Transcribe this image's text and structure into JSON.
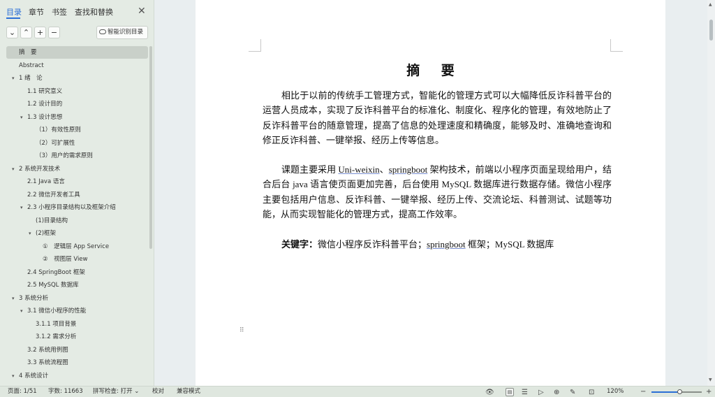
{
  "nav": {
    "tabs": [
      {
        "label": "目录",
        "active": true
      },
      {
        "label": "章节",
        "active": false
      },
      {
        "label": "书签",
        "active": false
      },
      {
        "label": "查找和替换",
        "active": false
      }
    ],
    "close_glyph": "✕",
    "toolbar": {
      "collapse_glyph": "⌄",
      "expand_glyph": "⌃",
      "add_glyph": "+",
      "remove_glyph": "−",
      "smart_toc_label": "智能识别目录"
    },
    "toc": [
      {
        "label": "摘　要",
        "level": 0,
        "arrow": "",
        "selected": true
      },
      {
        "label": "Abstract",
        "level": 0,
        "arrow": ""
      },
      {
        "label": "1  绪　论",
        "level": 0,
        "arrow": "▾"
      },
      {
        "label": "1.1 研究意义",
        "level": 1,
        "arrow": ""
      },
      {
        "label": "1.2 设计目的",
        "level": 1,
        "arrow": ""
      },
      {
        "label": "1.3 设计思想",
        "level": 1,
        "arrow": "▾"
      },
      {
        "label": "（1）有效性原则",
        "level": 2,
        "arrow": ""
      },
      {
        "label": "（2）可扩展性",
        "level": 2,
        "arrow": ""
      },
      {
        "label": "（3）用户的需求原则",
        "level": 2,
        "arrow": ""
      },
      {
        "label": "2 系统开发技术",
        "level": 0,
        "arrow": "▾"
      },
      {
        "label": "2.1 Java 语言",
        "level": 1,
        "arrow": ""
      },
      {
        "label": "2.2 微信开发者工具",
        "level": 1,
        "arrow": ""
      },
      {
        "label": "2.3 小程序目录结构以及框架介绍",
        "level": 1,
        "arrow": "▾"
      },
      {
        "label": "(1)目录结构",
        "level": 2,
        "arrow": ""
      },
      {
        "label": "(2)框架",
        "level": 2,
        "arrow": "▾"
      },
      {
        "label": "①　逻辑层 App Service",
        "level": 3,
        "arrow": ""
      },
      {
        "label": "②　视图层 View",
        "level": 3,
        "arrow": ""
      },
      {
        "label": "2.4 SpringBoot 框架",
        "level": 1,
        "arrow": ""
      },
      {
        "label": "2.5 MySQL 数据库",
        "level": 1,
        "arrow": ""
      },
      {
        "label": "3 系统分析",
        "level": 0,
        "arrow": "▾"
      },
      {
        "label": "3.1 微信小程序的性能",
        "level": 1,
        "arrow": "▾"
      },
      {
        "label": "3.1.1 项目背景",
        "level": 2,
        "arrow": ""
      },
      {
        "label": "3.1.2 需求分析",
        "level": 2,
        "arrow": ""
      },
      {
        "label": "3.2 系统用例图",
        "level": 1,
        "arrow": ""
      },
      {
        "label": "3.3  系统流程图",
        "level": 1,
        "arrow": ""
      },
      {
        "label": "4  系统设计",
        "level": 0,
        "arrow": "▾"
      }
    ]
  },
  "document": {
    "title": "摘 要",
    "para1": "相比于以前的传统手工管理方式，智能化的管理方式可以大幅降低反诈科普平台的运营人员成本，实现了反诈科普平台的标准化、制度化、程序化的管理，有效地防止了反诈科普平台的随意管理，提高了信息的处理速度和精确度，能够及时、准确地查询和修正反诈科普、一键举报、经历上传等信息。",
    "para2": {
      "p1": "课题主要采用 ",
      "t1": "Uni-weixin",
      "p2": "、",
      "t2": "springboot",
      "p3": " 架构技术，前端以小程序页面呈现给用户，结合后台 java 语言使页面更加完善，后台使用 MySQL 数据库进行数据存储。微信小程序主要包括用户信息、反诈科普、一键举报、经历上传、交流论坛、科普测试、试题等功能，从而实现智能化的管理方式，提高工作效率。"
    },
    "keywords": {
      "label": "关键字：",
      "p1": "微信小程序反诈科普平台；",
      "t1": "springboot",
      "p2": " 框架；MySQL 数据库"
    },
    "drag_glyph": "⠿"
  },
  "scrollbar": {
    "up_glyph": "▲",
    "down_glyph": "▼"
  },
  "status": {
    "page": "页面: 1/51",
    "words": "字数: 11663",
    "spell": "拼写检查: 打开 ⌄",
    "proofread": "校对",
    "compat": "兼容模式",
    "zoom": "120%",
    "zoom_fraction": 0.55,
    "icons": {
      "eye": "👁",
      "page_view": "▤",
      "outline": "☰",
      "play": "▷",
      "web": "⊕",
      "pen": "✎",
      "brush": "✐",
      "fit": "⊡",
      "minus": "−",
      "plus": "+"
    }
  }
}
